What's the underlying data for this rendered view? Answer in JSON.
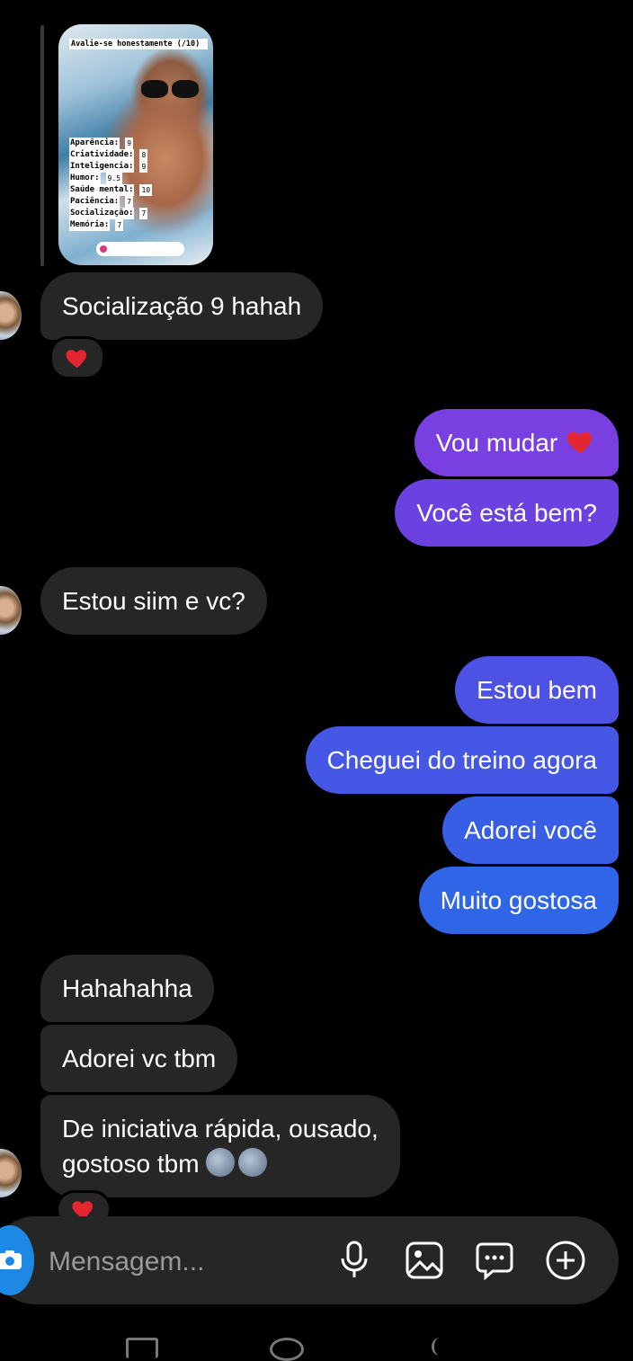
{
  "story": {
    "title": "Avalie-se honestamente (/10)",
    "stats": [
      {
        "label": "Aparência:",
        "value": "9"
      },
      {
        "label": "Criatividade:",
        "value": "8"
      },
      {
        "label": "Inteligencia:",
        "value": "9"
      },
      {
        "label": "Humor:",
        "value": "9.5"
      },
      {
        "label": "Saúde mental:",
        "value": "10"
      },
      {
        "label": "Paciência:",
        "value": "7"
      },
      {
        "label": "Socialização:",
        "value": "7"
      },
      {
        "label": "Memória:",
        "value": "7"
      }
    ]
  },
  "messages": {
    "m1": "Socialização 9 hahah",
    "m2": "Vou mudar ",
    "m3": "Você está bem?",
    "m4": "Estou siim e vc?",
    "m5": "Estou bem",
    "m6": "Cheguei do treino agora",
    "m7": "Adorei você",
    "m8": "Muito gostosa",
    "m9": "Hahahahha",
    "m10": "Adorei vc tbm",
    "m11_line1": "De iniciativa rápida, ousado,",
    "m11_line2": "gostoso tbm "
  },
  "composer": {
    "placeholder": "Mensagem..."
  },
  "colors": {
    "outgoing_gradient": [
      "#7b3fe0",
      "#5f4be3",
      "#3f5de6",
      "#2f66e8"
    ],
    "incoming": "#262626",
    "camera": "#1e88e5"
  }
}
